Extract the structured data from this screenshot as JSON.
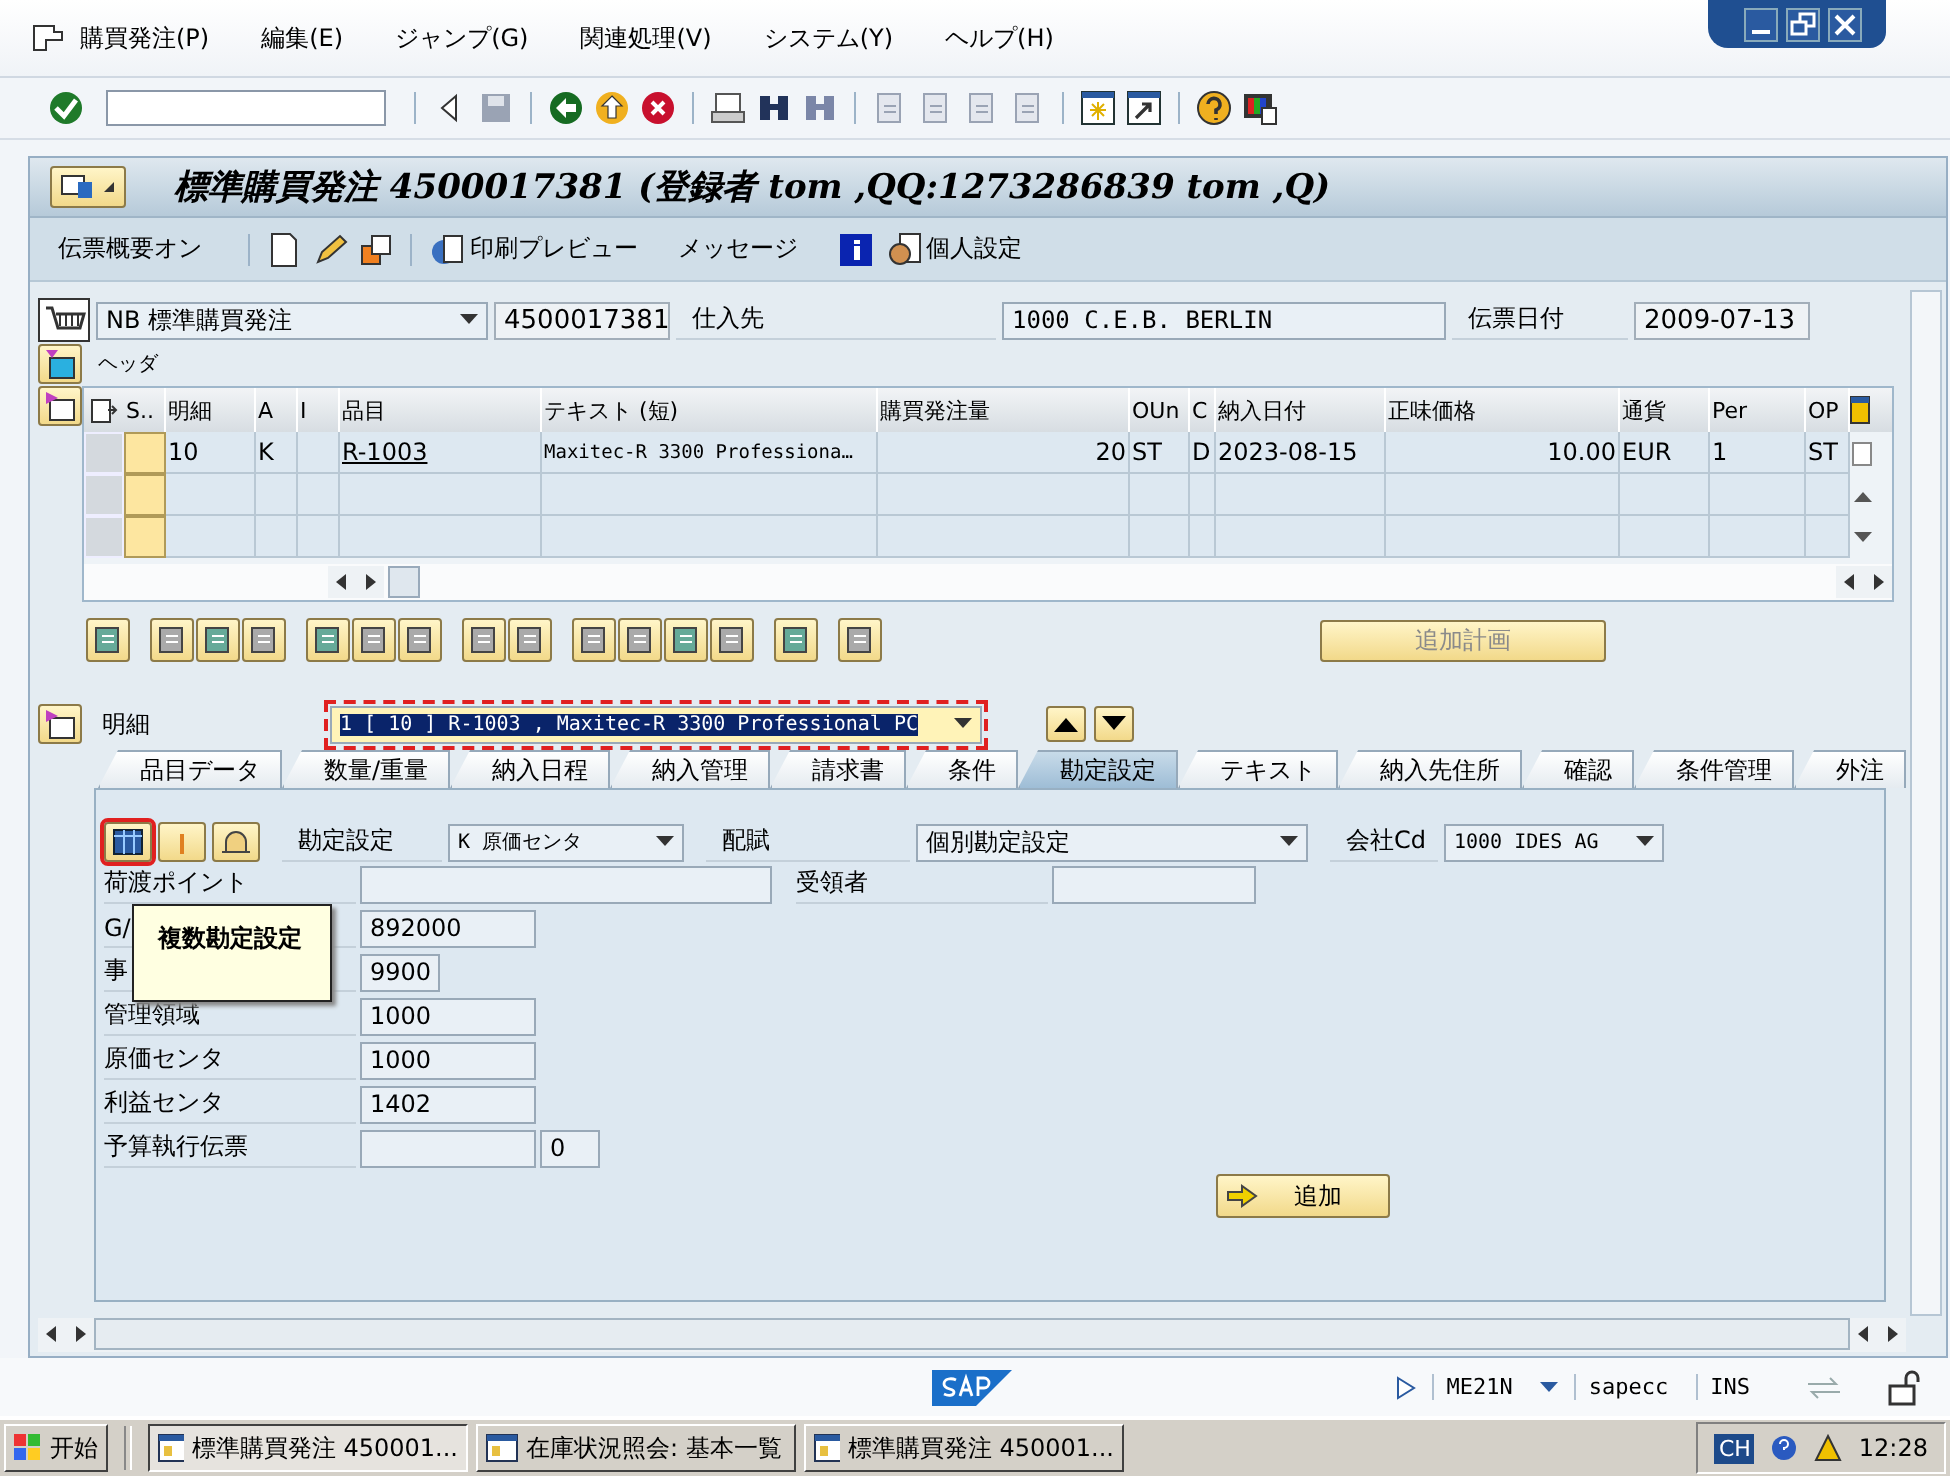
{
  "menu": [
    "購買発注(P)",
    "編集(E)",
    "ジャンプ(G)",
    "関連処理(V)",
    "システム(Y)",
    "ヘルプ(H)"
  ],
  "title": "標準購買発注 4500017381 (登録者 tom ,QQ:1273286839 tom ,Q)",
  "app_toolbar": [
    "伝票概要オン",
    "印刷プレビュー",
    "メッセージ",
    "個人設定"
  ],
  "header": {
    "doc_type": "NB 標準購買発注",
    "po_number": "4500017381",
    "vendor_label": "仕入先",
    "vendor": "1000 C.E.B. BERLIN",
    "date_label": "伝票日付",
    "date": "2009-07-13",
    "section_label": "ヘッダ"
  },
  "items_table": {
    "columns": [
      "S..",
      "明細",
      "A",
      "I",
      "品目",
      "テキスト (短)",
      "購買発注量",
      "OUn",
      "C",
      "納入日付",
      "正味価格",
      "通貨",
      "Per",
      "OP"
    ],
    "rows": [
      {
        "checked": false,
        "cells": [
          null,
          "10",
          "K",
          null,
          "R-1003",
          "Maxitec-R 3300 Professiona…",
          "20",
          "ST",
          "D",
          "2023-08-15",
          "10.00",
          "EUR",
          "1",
          "ST"
        ]
      }
    ]
  },
  "schedule_button": {
    "label": "追加計画",
    "disabled": true
  },
  "item_selector": {
    "label": "明細",
    "value": "1 [ 10 ] R-1003 , Maxitec-R 3300 Professional PC",
    "focused": true
  },
  "tabs": [
    {
      "label": "品目データ",
      "selected": false
    },
    {
      "label": "数量/重量",
      "selected": false
    },
    {
      "label": "納入日程",
      "selected": false
    },
    {
      "label": "納入管理",
      "selected": false
    },
    {
      "label": "請求書",
      "selected": false
    },
    {
      "label": "条件",
      "selected": false
    },
    {
      "label": "勘定設定",
      "selected": true
    },
    {
      "label": "テキスト",
      "selected": false
    },
    {
      "label": "納入先住所",
      "selected": false
    },
    {
      "label": "確認",
      "selected": false
    },
    {
      "label": "条件管理",
      "selected": false
    },
    {
      "label": "外注",
      "selected": false
    }
  ],
  "account_assignment": {
    "category_label": "勘定設定",
    "category": "K 原価センタ",
    "distribution_label": "配賦",
    "distribution": "個別勘定設定",
    "company_label": "会社Cd",
    "company": "1000 IDES AG",
    "unloading_label": "荷渡ポイント",
    "recipient_label": "受領者",
    "fields": [
      {
        "label": "G/",
        "value": "892000"
      },
      {
        "label": "事",
        "value": "9900"
      },
      {
        "label": "管理領域",
        "value": "1000"
      },
      {
        "label": "原価センタ",
        "value": "1000"
      },
      {
        "label": "利益センタ",
        "value": "1402"
      }
    ],
    "commitment_label": "予算執行伝票",
    "commitment_item": "0",
    "tooltip": "複数勘定設定",
    "add_button": "追加"
  },
  "status_bar": {
    "transaction": "ME21N",
    "system": "sapecc",
    "mode": "INS"
  },
  "taskbar": {
    "start": "开始",
    "tasks": [
      {
        "label": "標準購買発注 450001...",
        "selected": true
      },
      {
        "label": "在庫状況照会: 基本一覧",
        "selected": false
      },
      {
        "label": "標準購買発注 450001...",
        "selected": false
      }
    ],
    "language": "CH",
    "clock": "12:28"
  }
}
